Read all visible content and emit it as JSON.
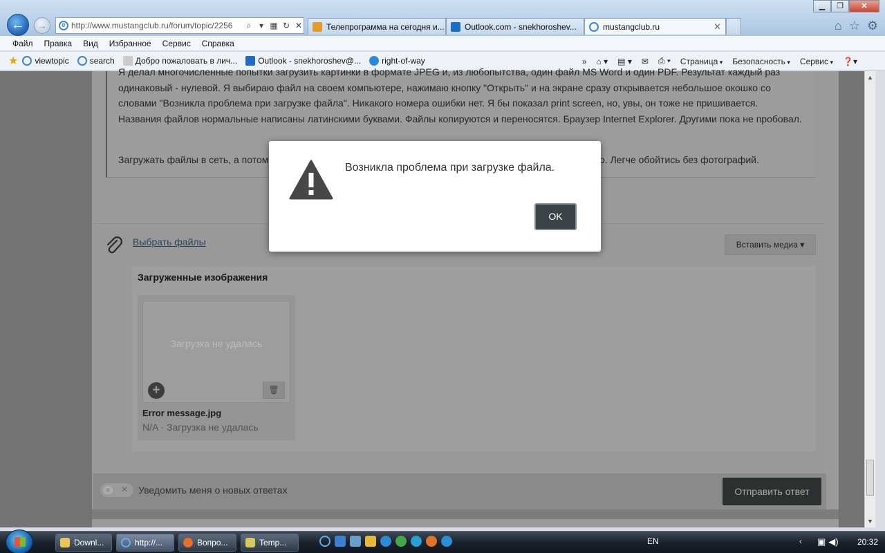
{
  "browser": {
    "address_url": "http://www.mustangclub.ru/forum/topic/2256",
    "tabs": [
      {
        "label": "Телепрограмма на сегодня и..."
      },
      {
        "label": "Outlook.com - snekhoroshev..."
      },
      {
        "label": "mustangclub.ru"
      }
    ],
    "menu": [
      "Файл",
      "Правка",
      "Вид",
      "Избранное",
      "Сервис",
      "Справка"
    ],
    "favorites": [
      "viewtopic",
      "search",
      "Добро пожаловать в лич...",
      "Outlook - snekhoroshev@...",
      "right-of-way"
    ],
    "commands": [
      "Страница",
      "Безопасность",
      "Сервис"
    ]
  },
  "post": {
    "paragraph1": "Я делал многочисленные попытки загрузить картинки в формате JPEG и, из любопытства, один файл MS Word и один PDF. Результат каждый раз одинаковый - нулевой.  Я выбираю файл на своем компьютере, нажимаю кнопку \"Открыть\" и на экране сразу открывается небольшое окошко со словами \"Возникла проблема при загрузке файла\". Никакого номера ошибки нет. Я бы показал print screen, но, увы, он тоже не пришивается.  Названия файлов нормальные написаны латинскими буквами. Файлы копируются и переносятся. Браузер Internet Explorer. Другими пока не пробовал.",
    "paragraph2": "Загружать файлы в сеть, а потом давать ссылки на них для меня (и не только для меня, я думаю) непросто. Легче обойтись без фотографий."
  },
  "attachments": {
    "choose_files": "Выбрать файлы",
    "insert_media": "Вставить медиа ▾",
    "uploaded_title": "Загруженные изображения",
    "file": {
      "thumb_status": "Загрузка не удалась",
      "name": "Error message.jpg",
      "meta": "N/A · Загрузка не удалась"
    }
  },
  "footer": {
    "notify_label": "Уведомить меня о новых ответах",
    "submit_label": "Отправить ответ"
  },
  "dialog": {
    "message": "Возникла проблема при загрузке файла.",
    "ok_label": "OK"
  },
  "taskbar": {
    "buttons": [
      "Downl...",
      "http://...",
      "Вопро...",
      "Temp..."
    ],
    "language": "EN",
    "clock": "20:32"
  }
}
